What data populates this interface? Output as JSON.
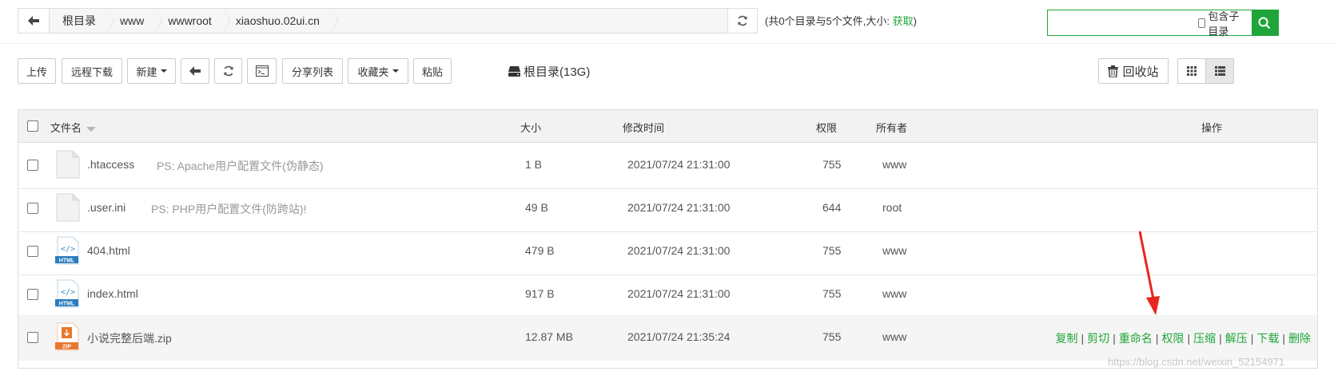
{
  "pathbar": {
    "crumbs": [
      "根目录",
      "www",
      "wwwroot",
      "xiaoshuo.02ui.cn"
    ]
  },
  "dir_info": {
    "text": "(共0个目录与5个文件,大小: ",
    "link": "获取",
    "suffix": ")"
  },
  "search": {
    "placeholder": "",
    "include_subdir_label": "包含子目录"
  },
  "toolbar": {
    "upload": "上传",
    "remote_download": "远程下载",
    "new": "新建",
    "share_list": "分享列表",
    "favorites": "收藏夹",
    "paste": "粘贴",
    "root_info": "根目录(13G)",
    "recycle_bin": "回收站"
  },
  "table": {
    "headers": {
      "name": "文件名",
      "size": "大小",
      "mtime": "修改时间",
      "perm": "权限",
      "owner": "所有者",
      "ops": "操作"
    },
    "rows": [
      {
        "name": ".htaccess",
        "ps": "PS: Apache用户配置文件(伪静态)",
        "size": "1 B",
        "mtime": "2021/07/24 21:31:00",
        "perm": "755",
        "owner": "www",
        "icon": "file-icon"
      },
      {
        "name": ".user.ini",
        "ps": "PS: PHP用户配置文件(防跨站)!",
        "size": "49 B",
        "mtime": "2021/07/24 21:31:00",
        "perm": "644",
        "owner": "root",
        "icon": "file-icon"
      },
      {
        "name": "404.html",
        "ps": "",
        "size": "479 B",
        "mtime": "2021/07/24 21:31:00",
        "perm": "755",
        "owner": "www",
        "icon": "html-icon"
      },
      {
        "name": "index.html",
        "ps": "",
        "size": "917 B",
        "mtime": "2021/07/24 21:31:00",
        "perm": "755",
        "owner": "www",
        "icon": "html-icon"
      },
      {
        "name": "小说完整后端.zip",
        "ps": "",
        "size": "12.87 MB",
        "mtime": "2021/07/24 21:35:24",
        "perm": "755",
        "owner": "www",
        "icon": "zip-icon"
      }
    ],
    "row_ops": [
      "复制",
      "剪切",
      "重命名",
      "权限",
      "压缩",
      "解压",
      "下载",
      "删除"
    ]
  },
  "icon_labels": {
    "html": "HTML",
    "zip": "ZIP"
  },
  "watermark": "https://blog.csdn.net/weixin_52154971",
  "colors": {
    "accent": "#20a53a",
    "annotation_arrow": "#e8251f"
  }
}
